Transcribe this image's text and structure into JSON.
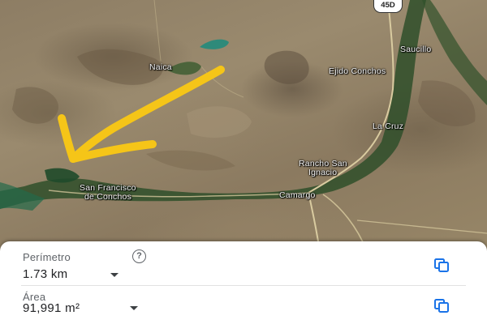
{
  "map": {
    "highway_shield": "45D",
    "places": {
      "naica": "Naica",
      "saucillo": "Saucillo",
      "ejido_conchos": "Ejido Conchos",
      "la_cruz": "La Cruz",
      "rancho_san_ignacio_1": "Rancho San",
      "rancho_san_ignacio_2": "Ignacio",
      "san_francisco_1": "San Francisco",
      "san_francisco_2": "de Conchos",
      "camargo": "Camargo"
    },
    "annotation": {
      "type": "hand-drawn arrow",
      "color": "#f5c518"
    }
  },
  "measure_panel": {
    "perimeter_label": "Perímetro",
    "perimeter_value": "1.73 km",
    "area_label": "Área",
    "area_value": "91,991 m²",
    "help_icon": "help-icon",
    "copy_icon": "copy-icon",
    "accent_color": "#1a73e8"
  }
}
